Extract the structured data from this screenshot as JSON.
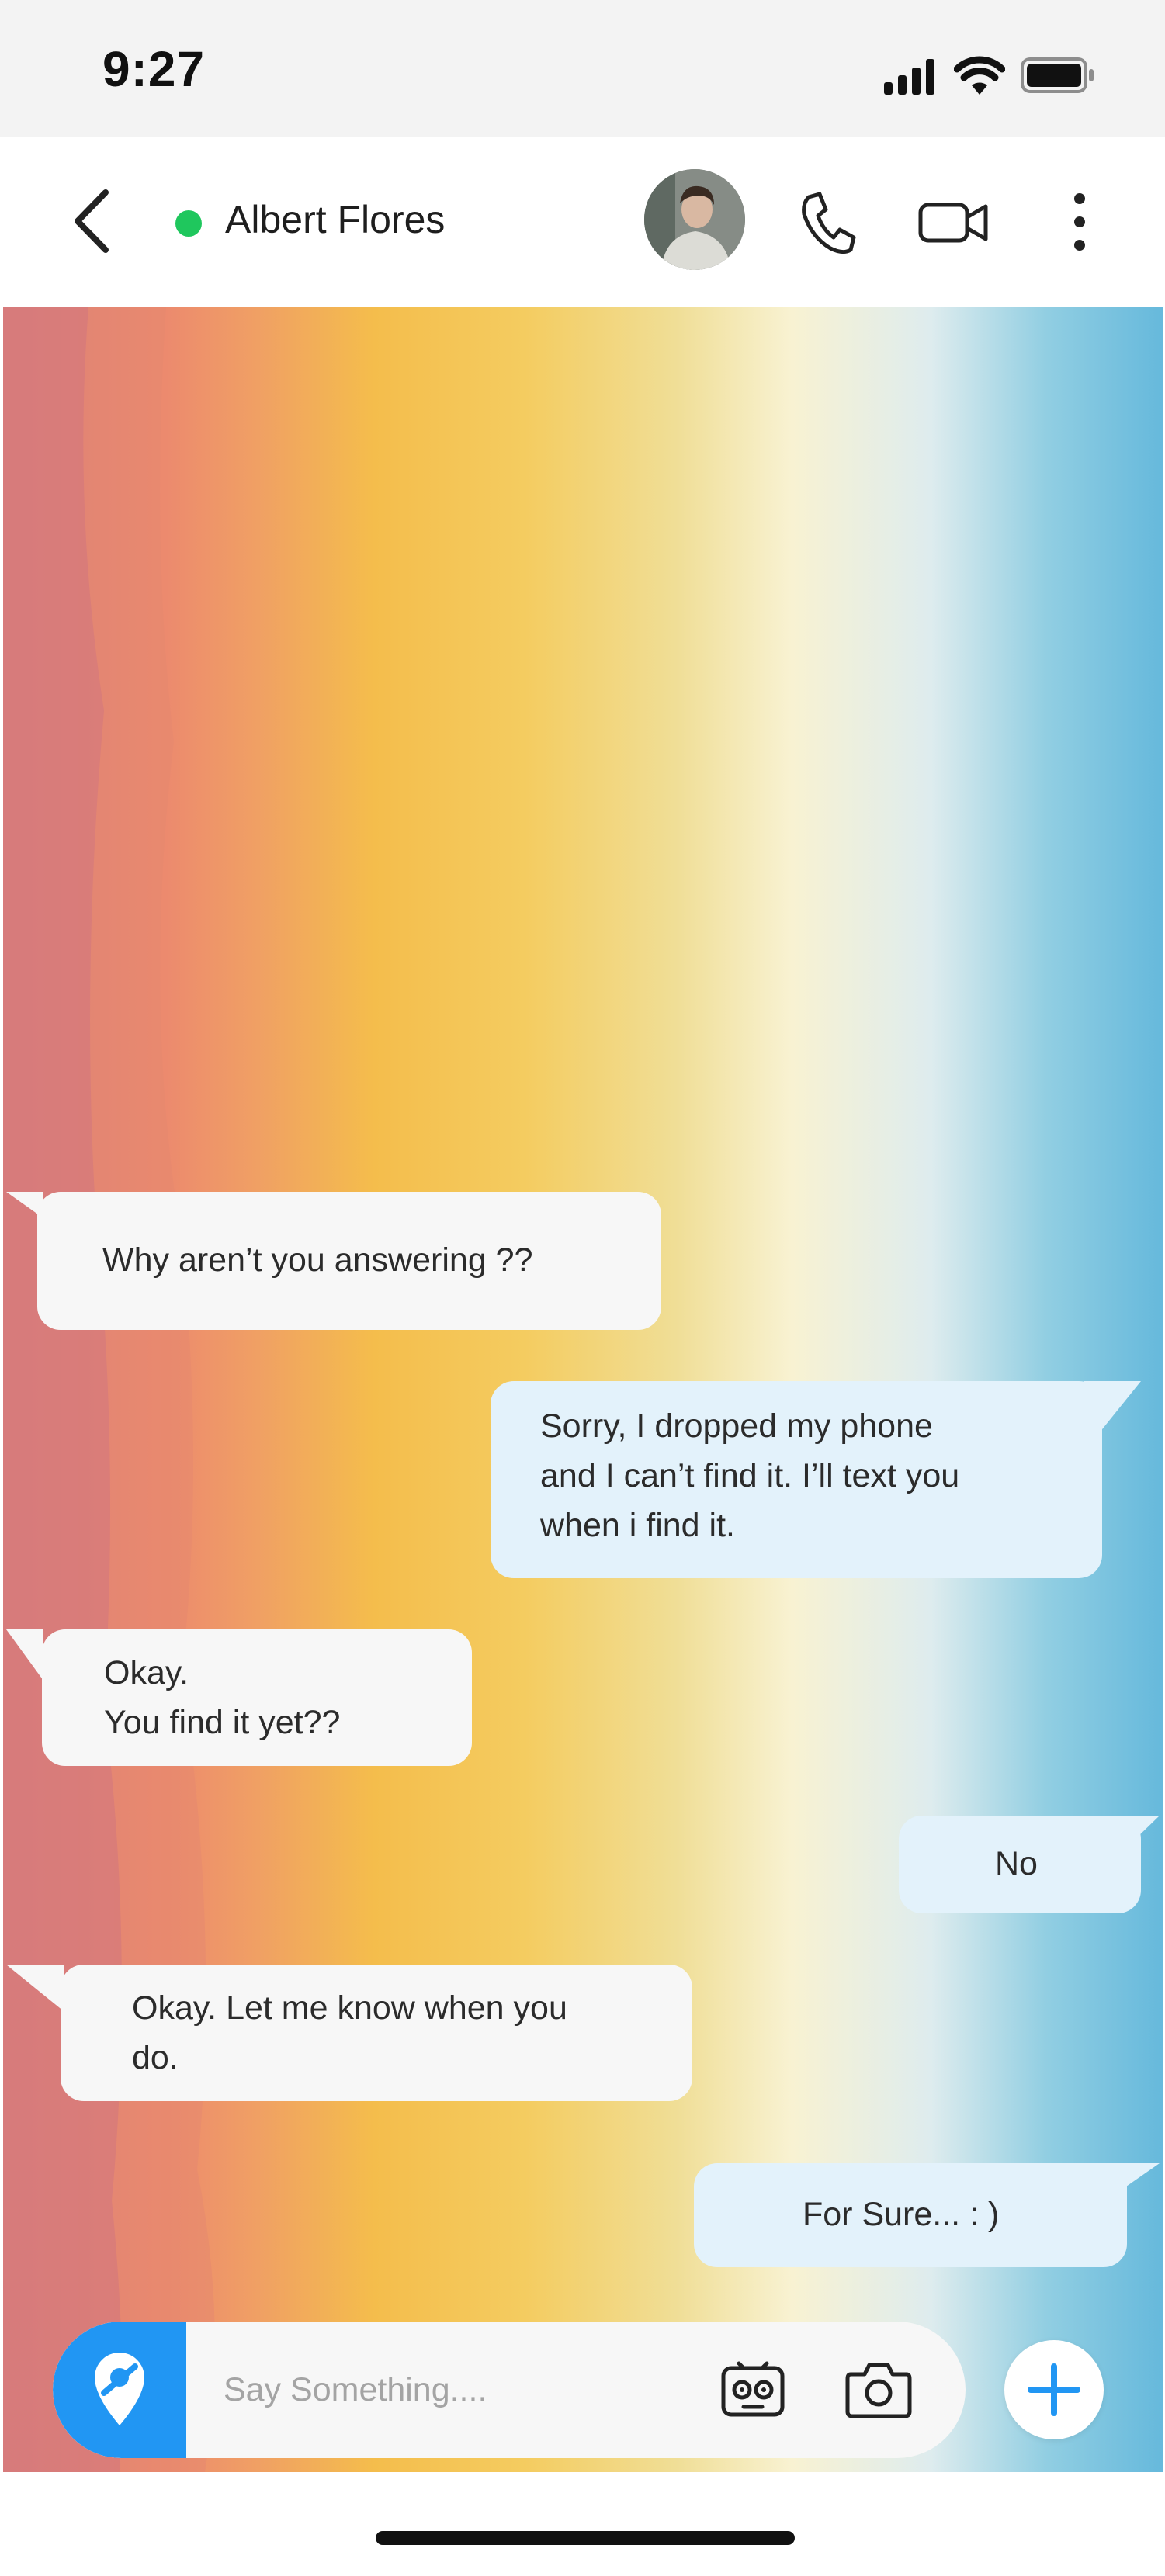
{
  "status_bar": {
    "time": "9:27",
    "icons": [
      "signal-icon",
      "wifi-icon",
      "battery-icon"
    ]
  },
  "header": {
    "contact_name": "Albert Flores",
    "online_color": "#1fc75d",
    "icons": [
      "back-icon",
      "avatar",
      "phone-icon",
      "video-icon",
      "more-icon"
    ]
  },
  "messages": [
    {
      "direction": "incoming",
      "text": "Why aren’t you answering ??"
    },
    {
      "direction": "outgoing",
      "text": "Sorry, I dropped my phone\nand I can’t find it. I’ll text you\nwhen i find it."
    },
    {
      "direction": "incoming",
      "text": "Okay.\nYou find it yet??"
    },
    {
      "direction": "outgoing",
      "text": "No"
    },
    {
      "direction": "incoming",
      "text": "Okay. Let me know when you\ndo."
    },
    {
      "direction": "outgoing",
      "text": "For Sure...   : )"
    }
  ],
  "composer": {
    "placeholder": "Say Something....",
    "value": "",
    "accent_color": "#2196f3",
    "icons": [
      "location-icon",
      "sticker-icon",
      "camera-icon",
      "plus-icon"
    ]
  },
  "colors": {
    "incoming_bubble": "#f7f7f7",
    "outgoing_bubble": "#e3f2fb"
  }
}
